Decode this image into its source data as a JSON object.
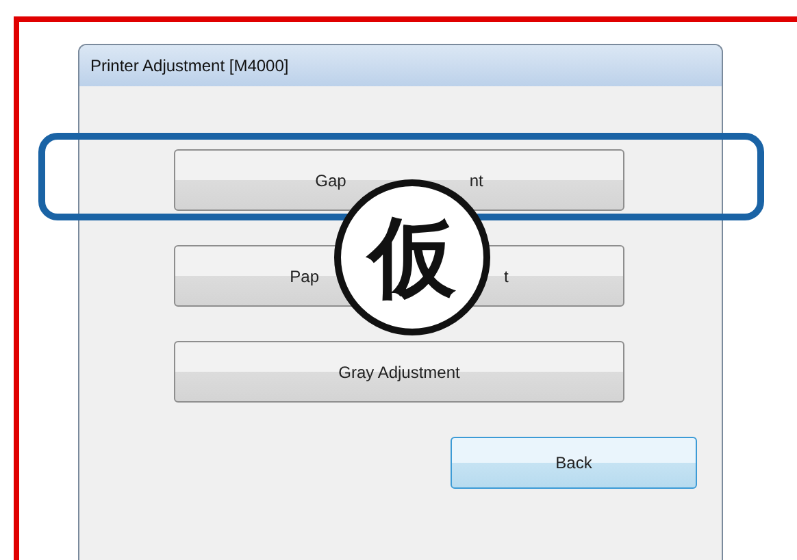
{
  "window": {
    "title": "Printer Adjustment [M4000]"
  },
  "highlight_frame": true,
  "buttons": [
    {
      "label_parts": [
        "Gap",
        "nt"
      ]
    },
    {
      "label_parts": [
        "Pap",
        "t"
      ]
    },
    {
      "label_parts": [
        "Gray Adjustment"
      ]
    }
  ],
  "back_button": {
    "label": "Back"
  },
  "stamp": {
    "text": "仮"
  }
}
